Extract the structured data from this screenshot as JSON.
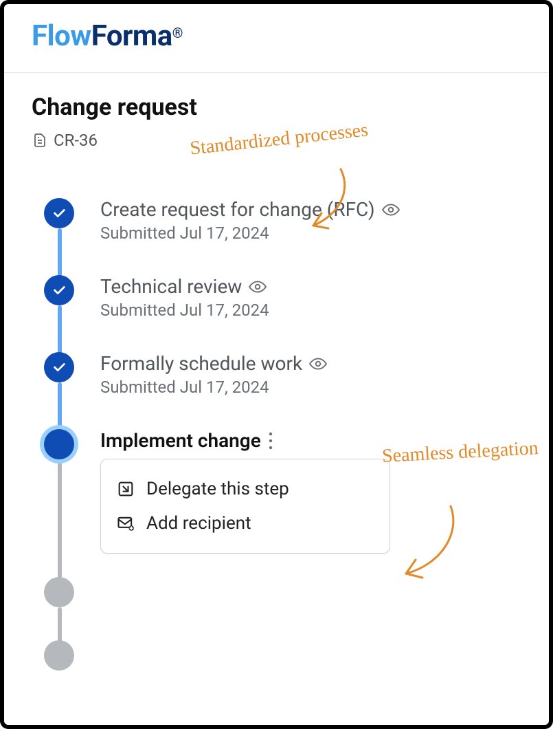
{
  "brand": {
    "part1": "Flow",
    "part2": "Forma"
  },
  "page_title": "Change request",
  "record_id": "CR-36",
  "steps": [
    {
      "title": "Create request for change (RFC)",
      "subtitle": "Submitted Jul 17, 2024",
      "status": "done",
      "connector": "blue",
      "view": true
    },
    {
      "title": "Technical review",
      "subtitle": "Submitted Jul 17, 2024",
      "status": "done",
      "connector": "blue",
      "view": true
    },
    {
      "title": "Formally schedule work",
      "subtitle": "Submitted Jul 17, 2024",
      "status": "done",
      "connector": "blue",
      "view": true
    },
    {
      "title": "Implement change",
      "subtitle": "",
      "status": "current",
      "connector": "gray",
      "view": false
    },
    {
      "title": "",
      "subtitle": "",
      "status": "future",
      "connector": "gray"
    },
    {
      "title": "",
      "subtitle": "",
      "status": "future"
    }
  ],
  "menu": {
    "items": [
      {
        "label": "Delegate this step",
        "icon": "delegate"
      },
      {
        "label": "Add recipient",
        "icon": "mail-plus"
      }
    ]
  },
  "annotations": {
    "processes": "Standardized processes",
    "delegation": "Seamless delegation"
  }
}
